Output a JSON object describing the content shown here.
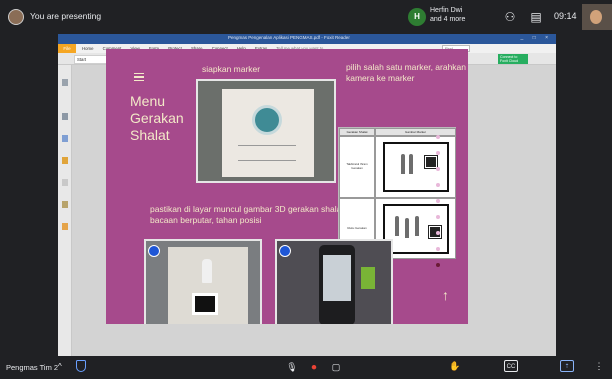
{
  "meet": {
    "presenting": "You are presenting",
    "participant_initial": "H",
    "participants_line1": "Herfin Dwi",
    "participants_line2": "and 4 more",
    "time": "09:14",
    "meeting_name": "Pengmas Tim 2",
    "chevron": "^",
    "icons": {
      "people": "people-icon",
      "chat": "chat-icon",
      "mic": "mic-icon",
      "hangup": "hangup-icon",
      "camera": "camera-icon",
      "hand": "raise-hand-icon",
      "captions": "captions-icon",
      "present": "present-icon",
      "more": "more-vert-icon"
    },
    "glyphs": {
      "people": "⚇",
      "chat": "▤",
      "mic": "🎙",
      "hangup": "⏺",
      "camera": "▢",
      "hand": "✋",
      "captions": "CC",
      "present": "⇡",
      "more": "⋮"
    },
    "colors": {
      "bar": "#202124",
      "hangup": "#ea4335",
      "present": "#8ab4f8",
      "avatar": "#2e7d32"
    }
  },
  "pdf": {
    "window_title": "Pengmas Pengenalan Aplikasi PENGMAS.pdf - Foxit Reader",
    "file_menu": "File",
    "menu": [
      "Home",
      "Comment",
      "View",
      "Form",
      "Protect",
      "Share",
      "Connect",
      "Help",
      "Extras"
    ],
    "tell_me": "Tell me what you want to",
    "find": "Find",
    "tab_start": "Start",
    "tab_doc": "Pengenalan Pengenalan A...",
    "tab_close": "×",
    "connect_btn": "Connect to Foxit Cloud",
    "window_buttons": "_ □ ×"
  },
  "slide": {
    "menu_title": "Menu Gerakan Shalat",
    "step1": "siapkan marker",
    "step2": "pilih salah satu marker, arahkan kamera ke marker",
    "step3": "pastikan di layar muncul gambar 3D gerakan shalat dan audio bacaan berputar, tahan posisi",
    "table_header_1": "Gerakan Shalat",
    "table_header_2": "Gambar Marker",
    "row1_label": "Takbiratul Ihram Gerakan",
    "row2_label": "Ruku Gerakan",
    "colors": {
      "bg": "#a64a8c",
      "text": "#f3e9c8",
      "play": "#1e56d6"
    },
    "dot_count": 9,
    "active_dot": 8
  }
}
